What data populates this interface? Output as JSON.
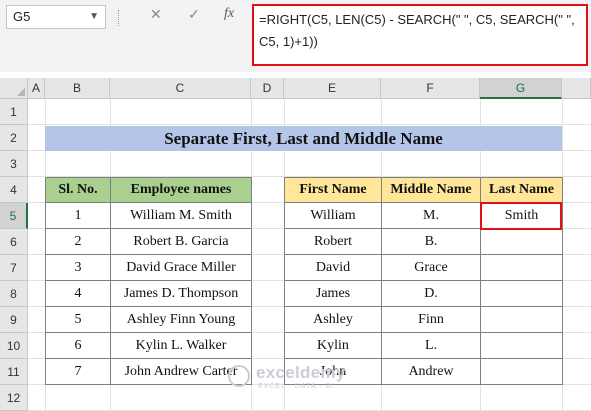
{
  "formula_bar": {
    "name_box": "G5",
    "cancel_icon": "✕",
    "enter_icon": "✓",
    "fx_label": "fx",
    "formula": "=RIGHT(C5, LEN(C5) - SEARCH(\" \", C5, SEARCH(\" \", C5, 1)+1))"
  },
  "columns": [
    "A",
    "B",
    "C",
    "D",
    "E",
    "F",
    "G"
  ],
  "selected_column": "G",
  "rows": [
    "1",
    "2",
    "3",
    "4",
    "5",
    "6",
    "7",
    "8",
    "9",
    "10",
    "11",
    "12"
  ],
  "selected_row": "5",
  "title": "Separate First, Last and Middle Name",
  "employee_table": {
    "headers": [
      "Sl. No.",
      "Employee names"
    ],
    "rows": [
      [
        "1",
        "William M. Smith"
      ],
      [
        "2",
        "Robert B. Garcia"
      ],
      [
        "3",
        "David Grace Miller"
      ],
      [
        "4",
        "James D. Thompson"
      ],
      [
        "5",
        "Ashley Finn Young"
      ],
      [
        "6",
        "Kylin L. Walker"
      ],
      [
        "7",
        "John Andrew Carter"
      ]
    ]
  },
  "name_table": {
    "headers": [
      "First Name",
      "Middle Name",
      "Last Name"
    ],
    "rows": [
      [
        "William",
        "M.",
        "Smith"
      ],
      [
        "Robert",
        "B.",
        ""
      ],
      [
        "David",
        "Grace",
        ""
      ],
      [
        "James",
        "D.",
        ""
      ],
      [
        "Ashley",
        "Finn",
        ""
      ],
      [
        "Kylin",
        "L.",
        ""
      ],
      [
        "John",
        "Andrew",
        ""
      ]
    ]
  },
  "watermark": {
    "name": "exceldemy",
    "tagline": "EXCEL · DATA · BI"
  },
  "colors": {
    "title_bg": "#b4c6e7",
    "employee_header_bg": "#a9d08e",
    "name_header_bg": "#ffe699",
    "highlight_border": "#e0101a"
  }
}
